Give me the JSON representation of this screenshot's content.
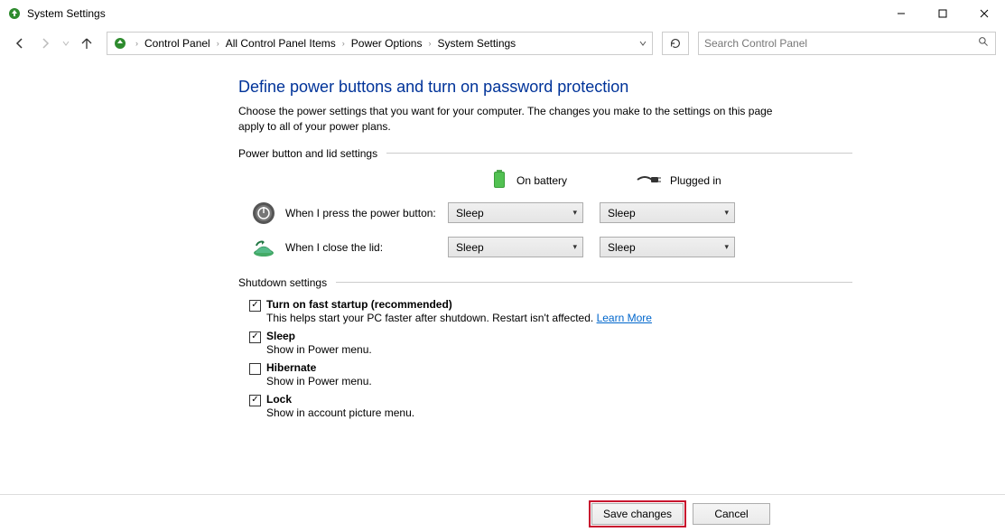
{
  "window": {
    "title": "System Settings"
  },
  "breadcrumb": {
    "items": [
      "Control Panel",
      "All Control Panel Items",
      "Power Options",
      "System Settings"
    ]
  },
  "search": {
    "placeholder": "Search Control Panel"
  },
  "page": {
    "heading": "Define power buttons and turn on password protection",
    "description": "Choose the power settings that you want for your computer. The changes you make to the settings on this page apply to all of your power plans."
  },
  "section_power": {
    "title": "Power button and lid settings",
    "col_battery": "On battery",
    "col_plugged": "Plugged in",
    "rows": [
      {
        "label": "When I press the power button:",
        "battery": "Sleep",
        "plugged": "Sleep"
      },
      {
        "label": "When I close the lid:",
        "battery": "Sleep",
        "plugged": "Sleep"
      }
    ]
  },
  "section_shutdown": {
    "title": "Shutdown settings",
    "items": [
      {
        "checked": true,
        "label": "Turn on fast startup (recommended)",
        "sub": "This helps start your PC faster after shutdown. Restart isn't affected. ",
        "link": "Learn More"
      },
      {
        "checked": true,
        "label": "Sleep",
        "sub": "Show in Power menu."
      },
      {
        "checked": false,
        "label": "Hibernate",
        "sub": "Show in Power menu."
      },
      {
        "checked": true,
        "label": "Lock",
        "sub": "Show in account picture menu."
      }
    ]
  },
  "footer": {
    "save": "Save changes",
    "cancel": "Cancel"
  }
}
